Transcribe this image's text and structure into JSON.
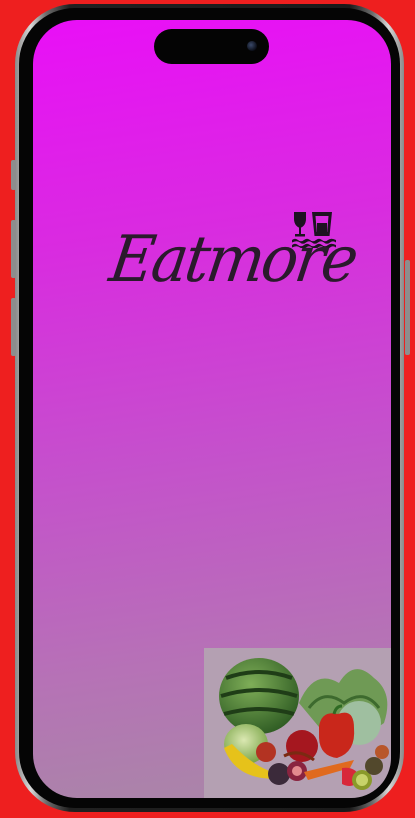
{
  "app": {
    "brand_name": "Eatmore",
    "logo_icon": "wine-glass-and-cup-icon",
    "hero_image": "fresh-produce-illustration"
  },
  "colors": {
    "page_background": "#ee1f1f",
    "gradient_top": "#e90ff7",
    "gradient_bottom": "#a888a6",
    "brand_text": "#2a1a2c"
  }
}
